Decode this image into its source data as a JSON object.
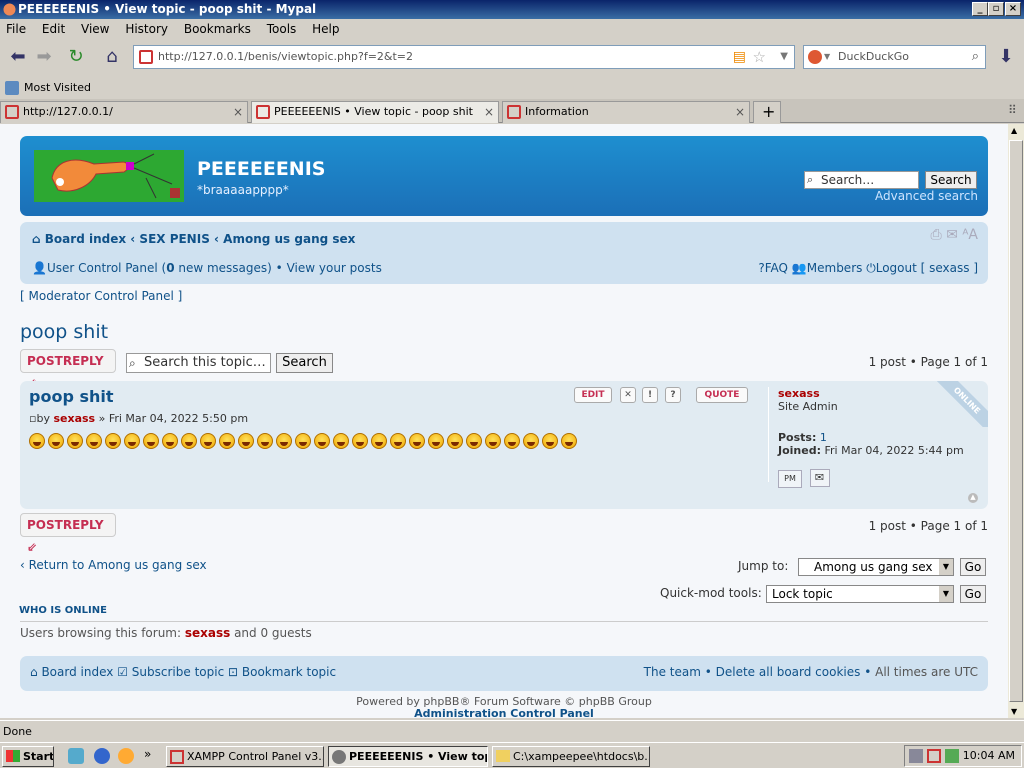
{
  "window": {
    "title": "PEEEEEENIS • View topic - poop shit - Mypal"
  },
  "menu": [
    "File",
    "Edit",
    "View",
    "History",
    "Bookmarks",
    "Tools",
    "Help"
  ],
  "address": {
    "url": "http://127.0.0.1/benis/viewtopic.php?f=2&t=2",
    "search_placeholder": "DuckDuckGo"
  },
  "bookmarks": {
    "most_visited": "Most Visited"
  },
  "tabs": [
    {
      "label": "http://127.0.0.1/"
    },
    {
      "label": "PEEEEEENIS • View topic - poop shit"
    },
    {
      "label": "Information"
    }
  ],
  "site": {
    "name": "PEEEEEENIS",
    "description": "*braaaaapppp*",
    "search_placeholder": "Search…",
    "search_button": "Search",
    "advanced_search": "Advanced search"
  },
  "breadcrumb": {
    "board_index": "Board index",
    "sep": "‹",
    "forum1": "SEX PENIS",
    "forum2": "Among us gang sex"
  },
  "userbar": {
    "ucp": "User Control Panel (",
    "count": "0",
    "ucp_end": " new messages)",
    "bullet": "•",
    "view_posts": "View your posts",
    "faq": "FAQ",
    "members": "Members",
    "logout": "Logout [ sexass ]"
  },
  "mcp": "[ Moderator Control Panel ]",
  "topic": {
    "title": "poop shit",
    "post_reply": "POSTREPLY",
    "search_placeholder": "Search this topic…",
    "search_button": "Search",
    "pagination": "1 post • Page 1 of 1"
  },
  "post": {
    "title": "poop shit",
    "by": "by",
    "author": "sexass",
    "date": "» Fri Mar 04, 2022 5:50 pm",
    "buttons": {
      "edit": "EDIT",
      "quote": "QUOTE"
    },
    "emoji_count": 29,
    "profile": {
      "username": "sexass",
      "rank": "Site Admin",
      "posts_label": "Posts:",
      "posts": "1",
      "joined_label": "Joined:",
      "joined": "Fri Mar 04, 2022 5:44 pm",
      "online": "ONLINE"
    }
  },
  "bottom": {
    "return": "‹ Return to Among us gang sex",
    "jump_label": "Jump to:",
    "jump_value": "Among us gang sex",
    "go": "Go",
    "quickmod_label": "Quick-mod tools:",
    "quickmod_value": "Lock topic"
  },
  "online": {
    "heading": "WHO IS ONLINE",
    "text_pre": "Users browsing this forum: ",
    "user": "sexass",
    "text_post": " and 0 guests"
  },
  "footer": {
    "board_index": "Board index",
    "subscribe": "Subscribe topic",
    "bookmark": "Bookmark topic",
    "team": "The team",
    "delete_cookies": "Delete all board cookies",
    "times": "All times are UTC",
    "powered": "Powered by phpBB® Forum Software © phpBB Group",
    "acp": "Administration Control Panel"
  },
  "status": {
    "text": "Done"
  },
  "taskbar": {
    "start": "Start",
    "tasks": [
      "XAMPP Control Panel v3....",
      "PEEEEEENIS • View top...",
      "C:\\xampeepee\\htdocs\\b..."
    ],
    "clock": "10:04 AM"
  }
}
